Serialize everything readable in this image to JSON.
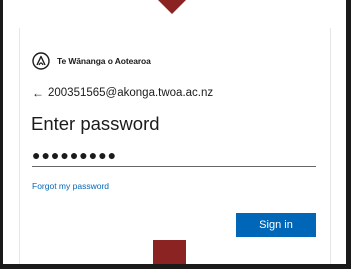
{
  "branding": {
    "logo_icon": "org-logo-icon",
    "org_name": "Te Wānanga o Aotearoa"
  },
  "signin": {
    "back_icon": "arrow-left-icon",
    "account": "200351565@akonga.twoa.ac.nz",
    "title": "Enter password",
    "password_value": "●●●●●●●●●",
    "forgot_label": "Forgot my password",
    "submit_label": "Sign in"
  },
  "colors": {
    "accent": "#0067b8",
    "marker": "#8b2323",
    "frame": "#1a1a1a"
  }
}
